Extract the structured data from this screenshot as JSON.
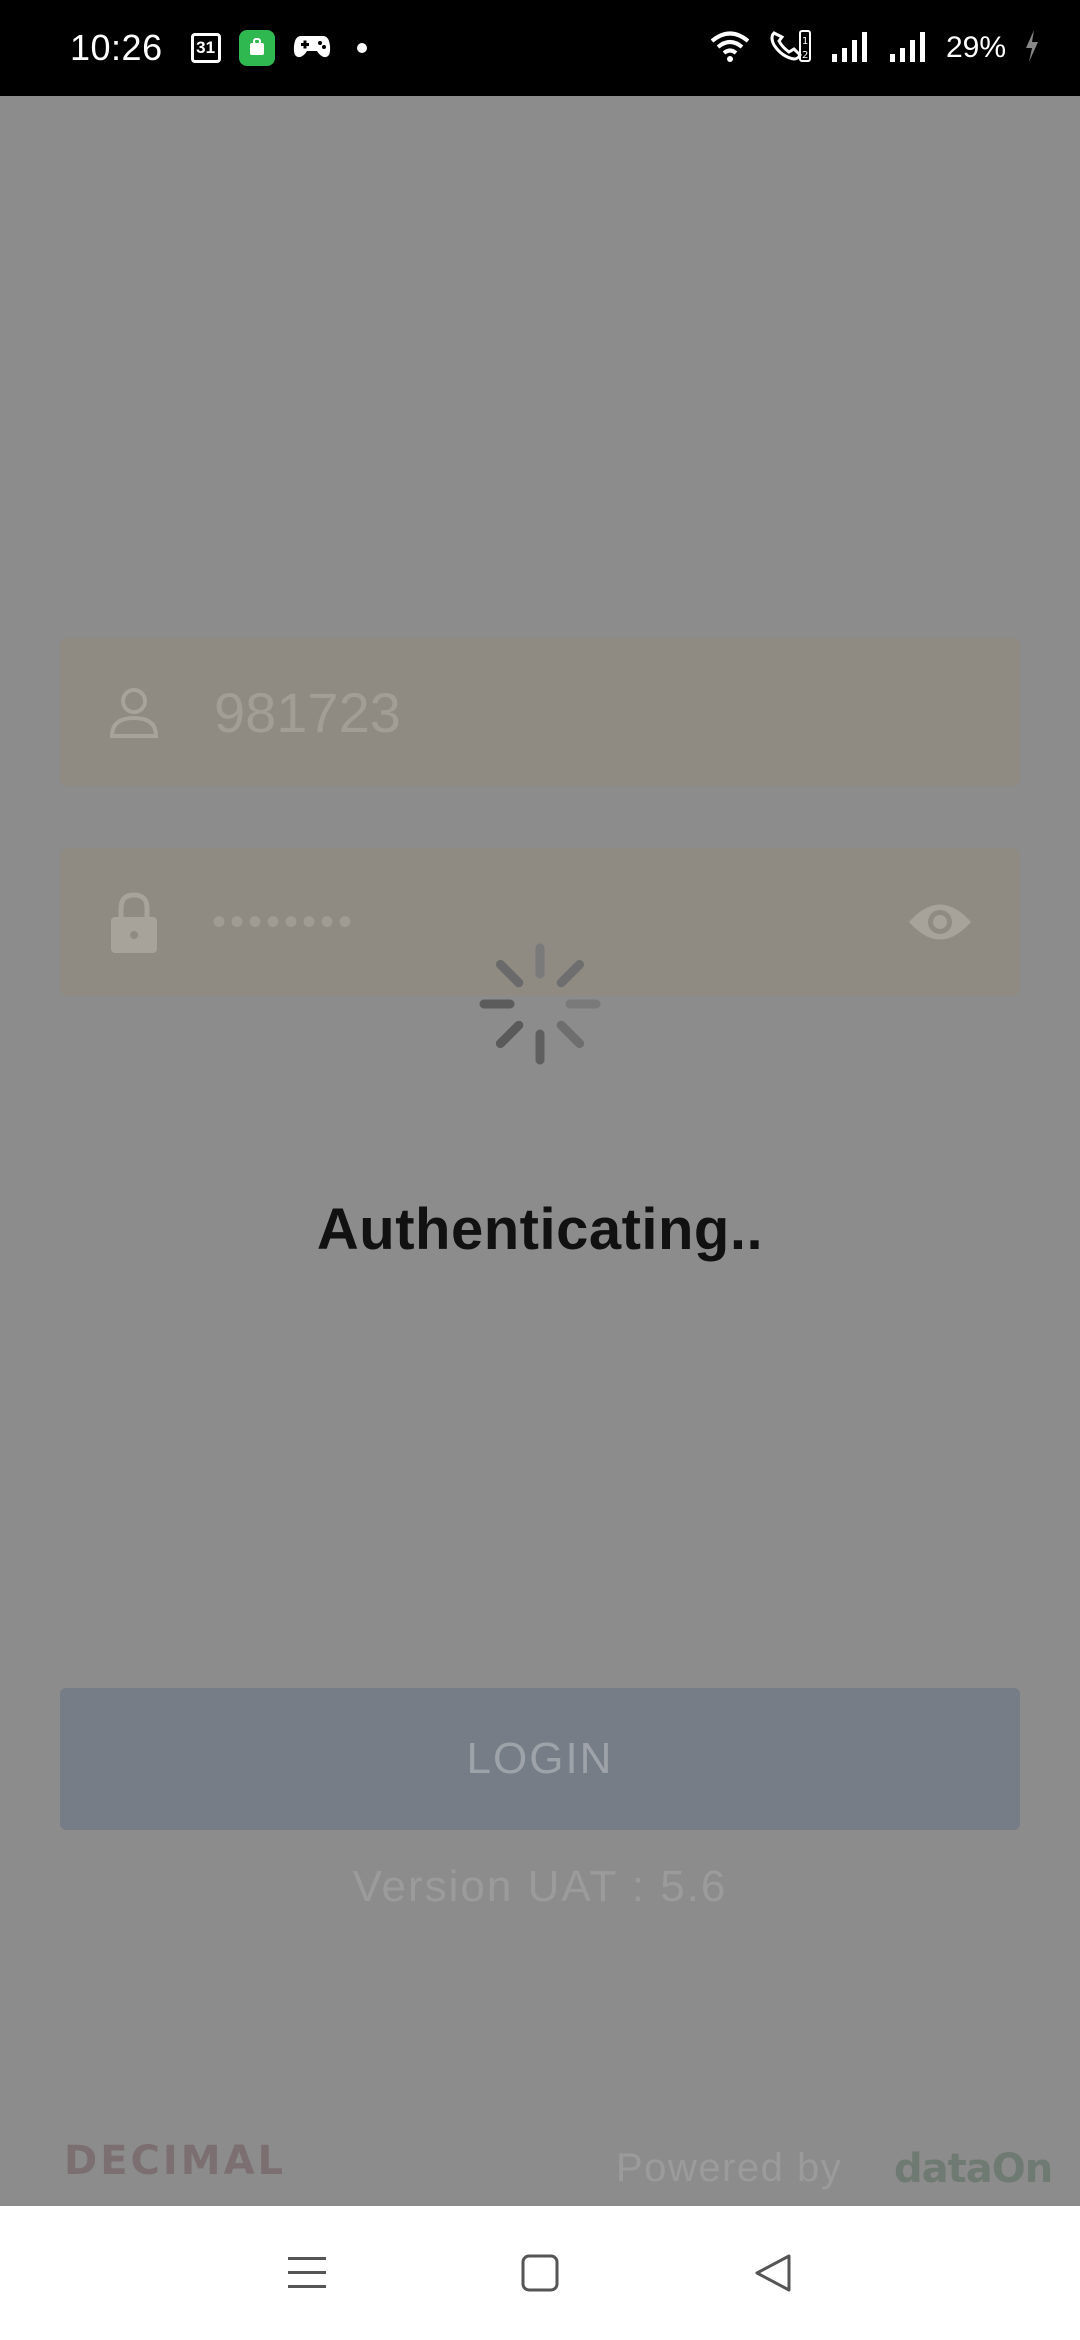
{
  "status_bar": {
    "time": "10:26",
    "calendar_day": "31",
    "battery": "29%"
  },
  "login": {
    "username_value": "981723",
    "password_mask": "••••••••",
    "button_label": "LOGIN",
    "version": "Version UAT : 5.6"
  },
  "overlay": {
    "message": "Authenticating.."
  },
  "footer": {
    "brand_left": "DECIMAL",
    "powered_by": "Powered by",
    "brand_right": "dataOn"
  },
  "colors": {
    "overlay_bg": "#8c8c8c",
    "field_bg": "#8f8a82",
    "button_bg": "#777d86",
    "status_bar": "#000000",
    "nav_bar": "#ffffff"
  },
  "icons": {
    "username": "person-icon",
    "password": "lock-icon",
    "toggle_password": "eye-icon",
    "loading": "spinner-icon"
  }
}
